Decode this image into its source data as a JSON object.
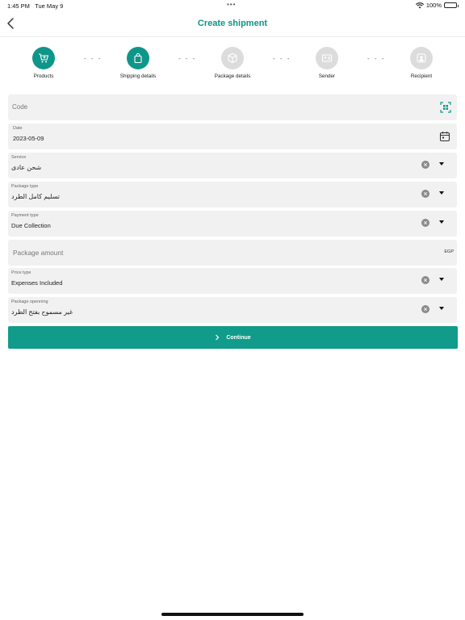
{
  "status": {
    "time": "1:45 PM",
    "date": "Tue May 9",
    "dots": "•••",
    "battery": "100%"
  },
  "nav": {
    "title": "Create shipment"
  },
  "steps": [
    {
      "label": "Products",
      "state": "done",
      "icon": "cart-icon"
    },
    {
      "label": "Shipping details",
      "state": "active",
      "icon": "bag-icon"
    },
    {
      "label": "Package details",
      "state": "pending",
      "icon": "box-icon"
    },
    {
      "label": "Sender",
      "state": "pending",
      "icon": "id-card-icon"
    },
    {
      "label": "Recipient",
      "state": "pending",
      "icon": "user-icon"
    }
  ],
  "step_separator": "- - -",
  "form": {
    "code": {
      "placeholder": "Code"
    },
    "date": {
      "label": "Date",
      "value": "2023-05-09"
    },
    "service": {
      "label": "Service",
      "value": "شحن عادى"
    },
    "package_type": {
      "label": "Package type",
      "value": "تسليم كامل الطرد"
    },
    "payment_type": {
      "label": "Payment type",
      "value": "Due Collection"
    },
    "package_amount": {
      "placeholder": "Package amount",
      "suffix": "EGP"
    },
    "price_type": {
      "label": "Price type",
      "value": "Expenses Included"
    },
    "package_opening": {
      "label": "Package openning",
      "value": "غير مسموح بفتح الطرد"
    }
  },
  "continue_label": "Continue",
  "colors": {
    "accent": "#0f968a",
    "field_bg": "#f1f1f1",
    "inactive_step": "#dcdcdc"
  }
}
